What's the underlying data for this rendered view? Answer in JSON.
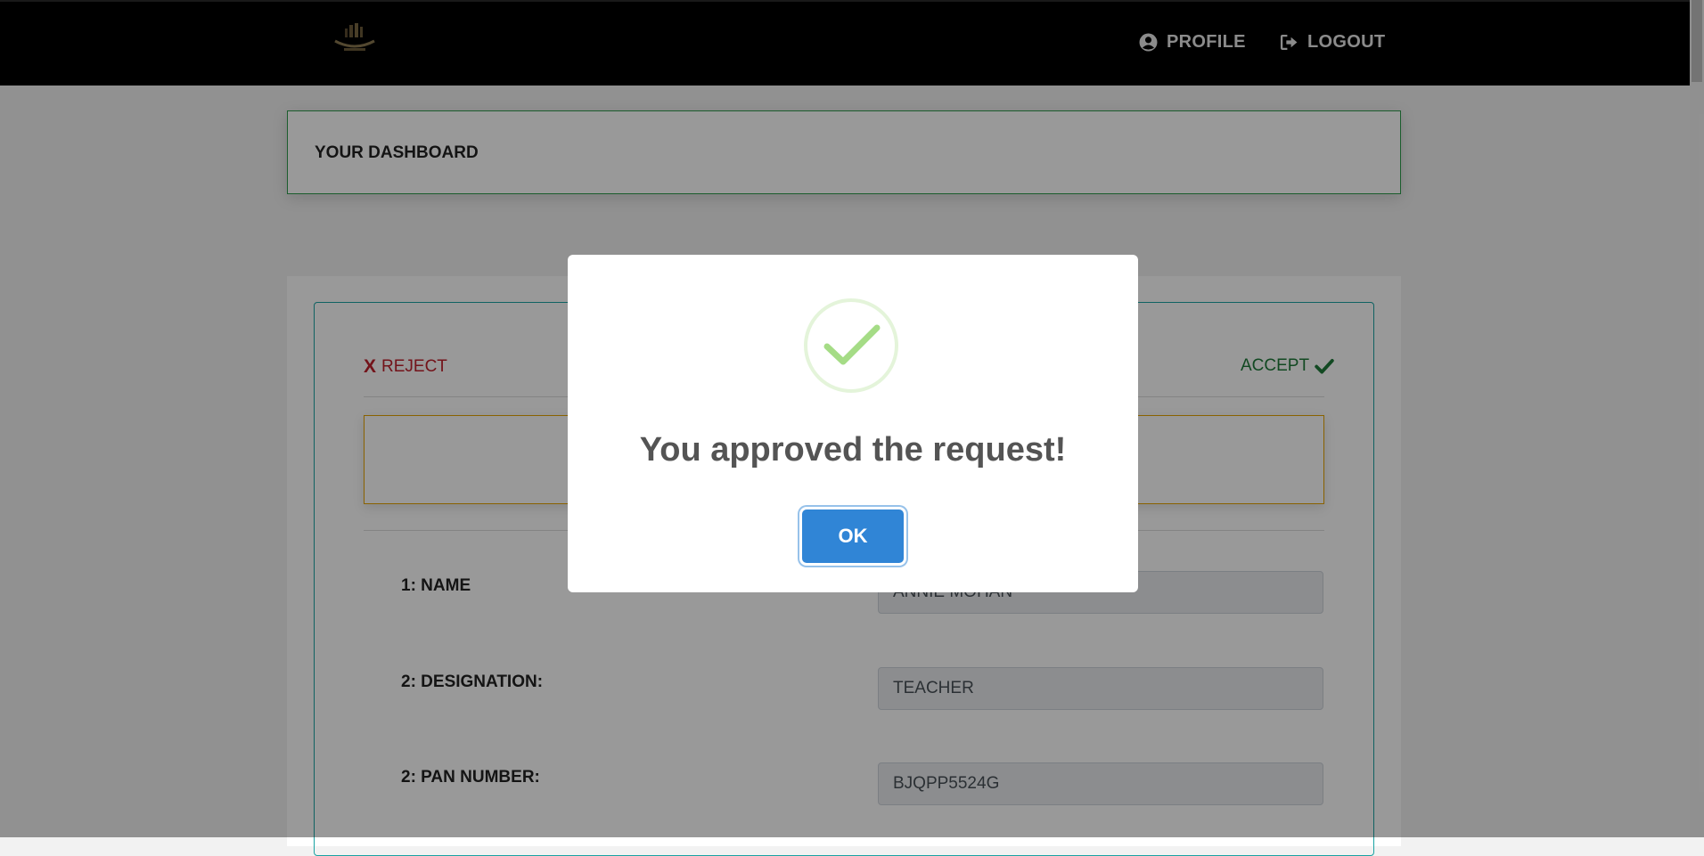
{
  "navbar": {
    "logo_icon": "institution-logo",
    "profile_label": "PROFILE",
    "profile_icon": "user-circle-icon",
    "logout_label": "LOGOUT",
    "logout_icon": "sign-out-icon"
  },
  "dashboard": {
    "title": "YOUR DASHBOARD"
  },
  "request": {
    "reject_mark": "X",
    "reject_label": "REJECT",
    "accept_label": "ACCEPT",
    "fields": [
      {
        "label": "1: NAME",
        "value": "ANNIE MOHAN"
      },
      {
        "label": "2: DESIGNATION:",
        "value": "TEACHER"
      },
      {
        "label": "2: PAN NUMBER:",
        "value": "BJQPP5524G"
      }
    ]
  },
  "modal": {
    "icon": "success-check-icon",
    "title": "You approved the request!",
    "ok_label": "OK"
  },
  "colors": {
    "reject": "#c0202c",
    "accept": "#1f7a3a",
    "ok_button": "#3085d6",
    "success_check": "#a5dc86"
  }
}
